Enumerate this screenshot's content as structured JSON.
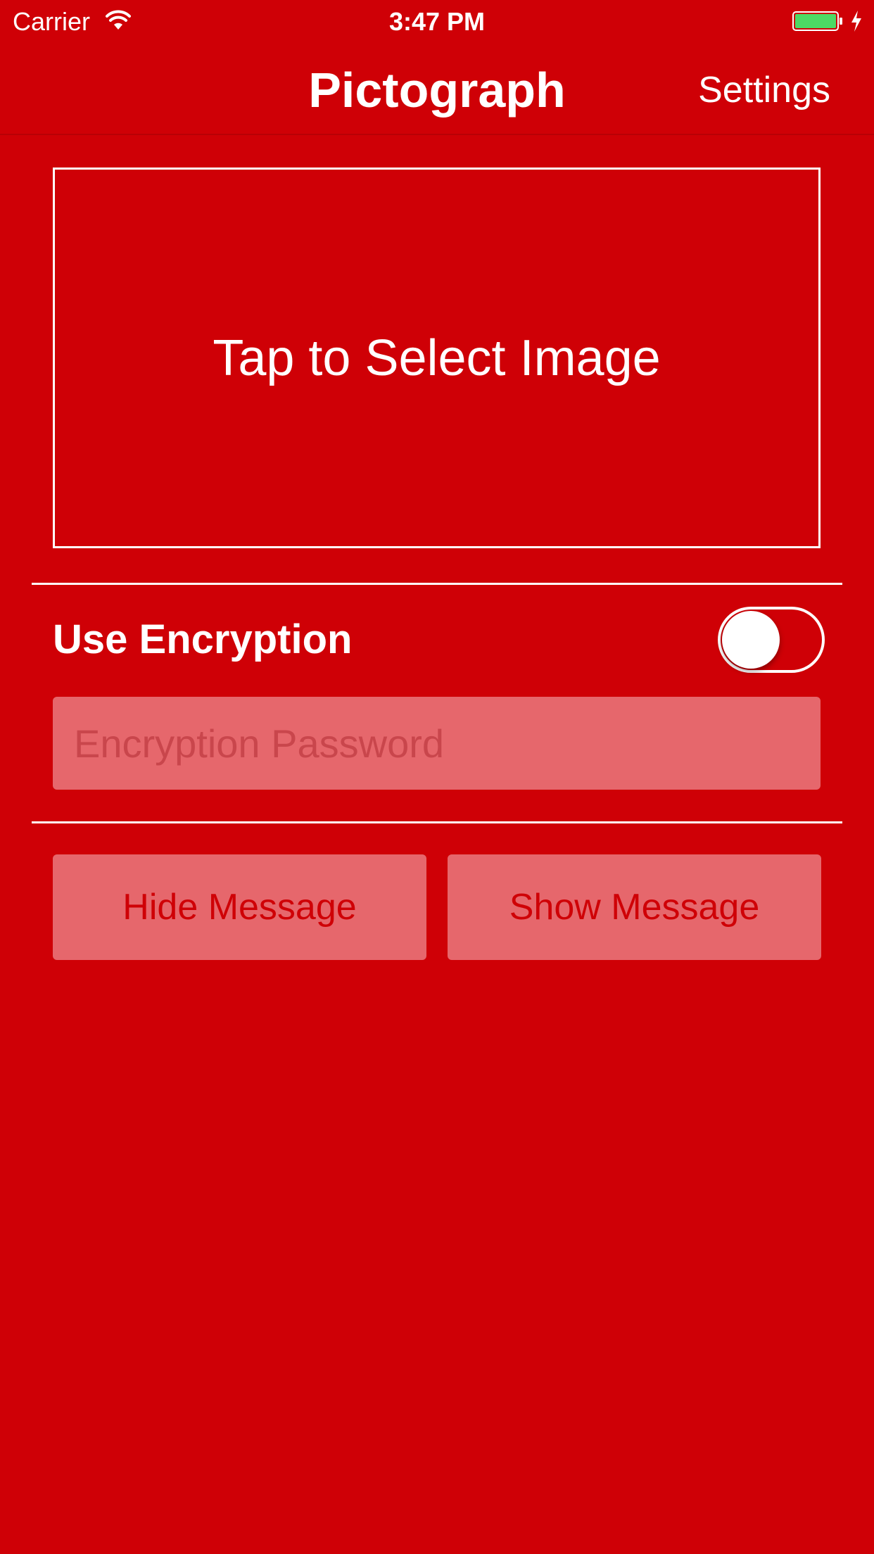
{
  "status_bar": {
    "carrier": "Carrier",
    "time": "3:47 PM",
    "wifi_icon": "wifi-icon",
    "battery_icon": "battery-icon",
    "charging_icon": "charging-bolt-icon",
    "battery_color": "#4cd964"
  },
  "nav": {
    "title": "Pictograph",
    "settings_label": "Settings"
  },
  "image_picker": {
    "label": "Tap to Select Image"
  },
  "encryption": {
    "label": "Use Encryption",
    "toggle_on": false,
    "password_placeholder": "Encryption Password",
    "password_value": ""
  },
  "actions": {
    "hide_label": "Hide Message",
    "show_label": "Show Message"
  },
  "colors": {
    "background": "#cf0006",
    "button_fill": "#e6676c",
    "button_text": "#cf0006",
    "foreground": "#ffffff"
  }
}
